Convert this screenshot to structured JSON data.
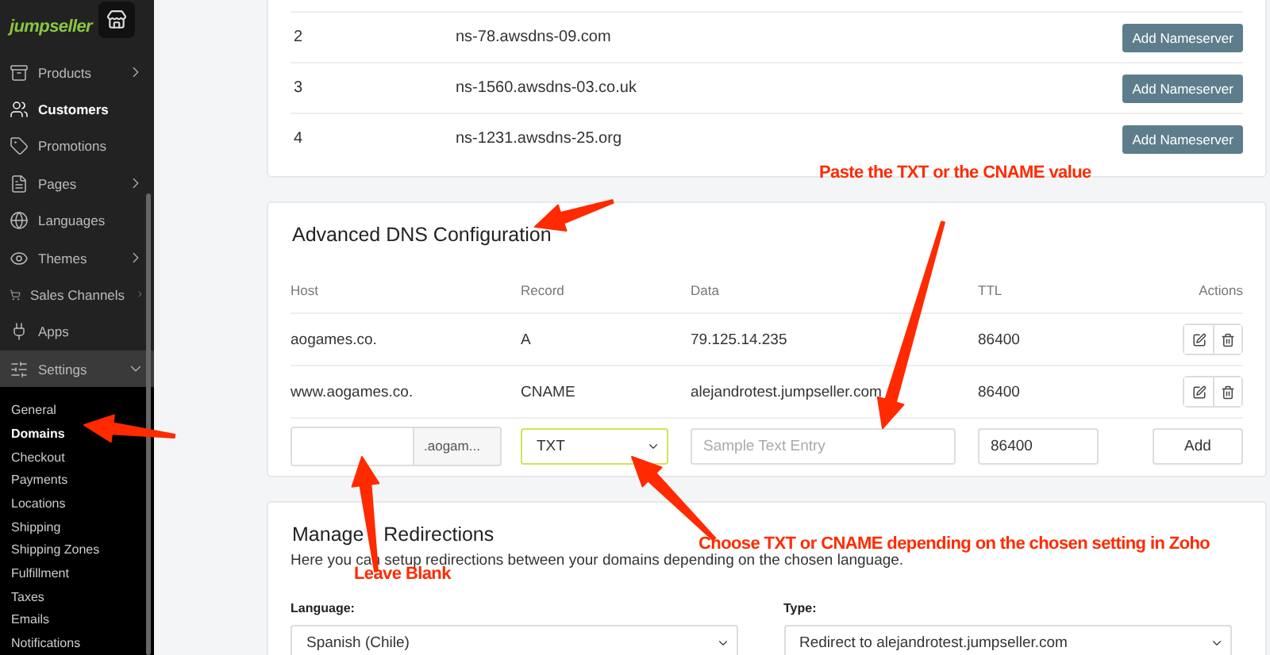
{
  "sidebar": {
    "logo": "jumpseller",
    "items": [
      {
        "label": "Products",
        "expanded": false,
        "selected": false,
        "bright": false
      },
      {
        "label": "Customers",
        "selected": false,
        "bright": true
      },
      {
        "label": "Promotions",
        "selected": false,
        "bright": false
      },
      {
        "label": "Pages",
        "expanded": false,
        "selected": false,
        "bright": false
      },
      {
        "label": "Languages",
        "selected": false,
        "bright": false
      },
      {
        "label": "Themes",
        "expanded": false,
        "selected": false,
        "bright": false
      },
      {
        "label": "Sales Channels",
        "expanded": false,
        "selected": false,
        "bright": false
      },
      {
        "label": "Apps",
        "selected": false,
        "bright": false
      },
      {
        "label": "Settings",
        "expanded": true,
        "selected": true,
        "bright": false,
        "children": [
          {
            "label": "General",
            "selected": false
          },
          {
            "label": "Domains",
            "selected": true
          },
          {
            "label": "Checkout",
            "selected": false
          },
          {
            "label": "Payments",
            "selected": false
          },
          {
            "label": "Locations",
            "selected": false
          },
          {
            "label": "Shipping",
            "selected": false
          },
          {
            "label": "Shipping Zones",
            "selected": false
          },
          {
            "label": "Fulfillment",
            "selected": false
          },
          {
            "label": "Taxes",
            "selected": false
          },
          {
            "label": "Emails",
            "selected": false
          },
          {
            "label": "Notifications",
            "selected": false
          }
        ]
      }
    ]
  },
  "nameservers": {
    "rows": [
      {
        "number": "2",
        "server": "ns-78.awsdns-09.com",
        "button": "Add Nameserver"
      },
      {
        "number": "3",
        "server": "ns-1560.awsdns-03.co.uk",
        "button": "Add Nameserver"
      },
      {
        "number": "4",
        "server": "ns-1231.awsdns-25.org",
        "button": "Add Nameserver"
      }
    ]
  },
  "dns": {
    "title": "Advanced DNS Configuration",
    "columns": [
      "Host",
      "Record",
      "Data",
      "TTL",
      "Actions"
    ],
    "rows": [
      {
        "host": "aogames.co.",
        "record": "A",
        "data": "79.125.14.235",
        "ttl": "86400"
      },
      {
        "host": "www.aogames.co.",
        "record": "CNAME",
        "data": "alejandrotest.jumpseller.com",
        "ttl": "86400"
      }
    ],
    "form": {
      "host_suffix": ".aogam...",
      "record": "TXT",
      "record_focused": true,
      "data_placeholder": "Sample Text Entry",
      "ttl": "86400",
      "button": "Add"
    }
  },
  "redirections": {
    "title": "Manage Redirections",
    "description": "Here you can setup redirections between your domains depending on the chosen language.",
    "language_label": "Language:",
    "language": "Spanish (Chile)",
    "type_label": "Type:",
    "type": "Redirect to alejandrotest.jumpseller.com"
  },
  "annotations": [
    "Paste the TXT or the CNAME value",
    "Leave Blank",
    "Choose TXT or CNAME depending on the chosen setting in Zoho"
  ]
}
